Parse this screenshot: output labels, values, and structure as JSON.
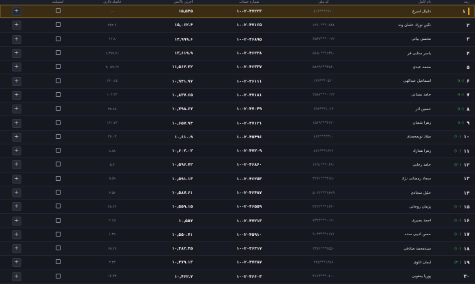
{
  "header": {
    "rank": "رتبه",
    "name": "نام کامل",
    "code": "کد ملی",
    "account": "شماره حساب",
    "balance": "آخرین بالانس",
    "distance": "فاصله دلاری",
    "consistency": "استیبلت"
  },
  "accent": "#e0a227",
  "rows": [
    {
      "rank": "۱",
      "badge": "",
      "name": "دانیال اسرغ",
      "code": "۲۷۱۰***۵۱۲",
      "account": "۱۰۰۲۰۴۷۲۲۳",
      "balance": "۱۵,۵۴۵",
      "distance": "--",
      "consistency": "lock-icon"
    },
    {
      "rank": "۲",
      "badge": "",
      "name": "نگین نوزاد عثمان وند",
      "code": "۰۷۸۸***۱۲۶۰",
      "account": "۱۰۰۲۰۴۷۱۶۵",
      "balance": "۱۵,۰۶۲.۴",
      "distance": "۴۸۲.۶",
      "consistency": "lock-icon"
    },
    {
      "rank": "۳",
      "badge": "",
      "name": "محسن بیاتی",
      "code": "۰۰۲۲***۶۵۳۷",
      "account": "۱۰۰۲۰۴۶۸۹۵",
      "balance": "۱۴,۹۹۹.۶",
      "distance": "۶۲.۸",
      "consistency": "lock-icon"
    },
    {
      "rank": "۴",
      "badge": "",
      "name": "یاسر ستایی فر",
      "code": "۱۳۹۰***۵۶۵۰",
      "account": "۱۰۰۲۰۴۶۲۲۸",
      "balance": "۱۳,۶۱۹.۹",
      "distance": "۱,۳۷۹.۷۱",
      "consistency": "lock-icon"
    },
    {
      "rank": "۵",
      "badge": "",
      "name": "محمد عبدی",
      "code": "۴۷۸۰***۵۸۲۹",
      "account": "۱۰۰۲۰۴۶۳۳۷",
      "balance": "۱۱,۵۶۲.۲۲",
      "distance": "۲,۰۵۷.۶۷",
      "consistency": "lock-icon"
    },
    {
      "rank": "۶",
      "badge": "(۱۰)",
      "name": "اسماعیل عبدالهی",
      "code": "۰۵۲۰***۱۴۹",
      "account": "۱۰۰۲۰۴۶۱۱۱",
      "balance": "۱۰,۹۴۱.۹۷",
      "distance": "۶۲۰.۲۵",
      "consistency": "lock-icon"
    },
    {
      "rank": "۷",
      "badge": "(۱۰)",
      "name": "حامد بستانی",
      "code": "۰۰۲۲***۲۵۸۷",
      "account": "۱۰۰۲۰۴۷۱۸۱",
      "balance": "۱۰,۸۳۷.۶۵",
      "distance": "۱۰۴.۳۲",
      "consistency": "lock-icon"
    },
    {
      "rank": "۸",
      "badge": "(۱۰)",
      "name": "حسین آذر",
      "code": "۱۰۶۴***۹۹۲",
      "account": "۱۰۰۲۰۴۷۰۴۹",
      "balance": "۱۰,۷۹۸.۶۷",
      "distance": "۳۸.۹۸",
      "consistency": "lock-icon"
    },
    {
      "rank": "۹",
      "badge": "(۱۰)",
      "name": "زهرا شعبان",
      "code": "۴۱۲۰***۱۵۶۹",
      "account": "۱۰۰۲۰۴۷۱۲۱",
      "balance": "۱۰,۶۵۷.۹۴",
      "distance": "۱۴۱.۷۳",
      "consistency": "lock-icon"
    },
    {
      "rank": "۱۰",
      "badge": "(۱۰)",
      "name": "میلاد نوبمحمدی",
      "code": "۳۳۱۰***۸۶۲",
      "account": "۱۰۰۲۰۴۵۴۹۶",
      "balance": "۱۰,۶۱۰.۹",
      "distance": "۴۶.۰۴",
      "consistency": "lock-icon"
    },
    {
      "rank": "۱۱",
      "badge": "(۱۰)",
      "name": "زهرا همازاد",
      "code": "۱۳۶۲***۸۷۱",
      "account": "۱۰۰۲۰۴۷۲۰۹",
      "balance": "۱۰,۶۰۲.۰۲",
      "distance": "۸.۸۸",
      "consistency": "lock-icon"
    },
    {
      "rank": "۱۲",
      "badge": "(۲۰)",
      "name": "حامد رجایی",
      "code": "۰۶۹۰***۱۴۹۱",
      "account": "۱۰۰۲۰۴۶۸۶۰",
      "balance": "۱۰,۵۹۶.۷۲",
      "distance": "۵.۳",
      "consistency": "lock-icon"
    },
    {
      "rank": "۱۳",
      "badge": "",
      "name": "سجاد رمضانی نژاد",
      "code": "۳۱۵۰***۳۲۷۱",
      "account": "۱۰۰۲۰۴۶۲۵۳",
      "balance": "۱۰,۵۹۱.۱۳",
      "distance": "۵.۵۹",
      "consistency": "lock-icon"
    },
    {
      "rank": "۱۴",
      "badge": "",
      "name": "خلیل سجادی",
      "code": "۱۸۲۹***۵۰۶۶",
      "account": "۱۰۰۲۰۴۶۴۸۷",
      "balance": "۱۰,۵۸۷.۶۱",
      "distance": "۳.۵۲",
      "consistency": "lock-icon"
    },
    {
      "rank": "۱۵",
      "badge": "(۱۰)",
      "name": "پژمان روحانی",
      "code": "۱۶۴۰***۴۴۲۲",
      "account": "۱۰۰۲۰۴۶۵۵۹",
      "balance": "۱۰,۵۵۹.۱۵",
      "distance": "۲۸.۴۶",
      "consistency": "lock-icon"
    },
    {
      "rank": "۱۶",
      "badge": "(۱۰)",
      "name": "احمد بصیری",
      "code": "۰۰۲۰***۷۳۴۴",
      "account": "۱۰۰۲۰۴۷۲۱۳",
      "balance": "۱۰,۵۵۷",
      "distance": "۲.۱۵",
      "consistency": "lock-icon"
    },
    {
      "rank": "۱۷",
      "badge": "(۱۰)",
      "name": "حسن ادیبی سده",
      "code": "۱۱۷۱***۹۰۴۳",
      "account": "۱۰۰۲۰۴۵۹۱۰",
      "balance": "۱۰,۵۵۰.۷۱",
      "distance": "۶.۲۹",
      "consistency": "lock-icon"
    },
    {
      "rank": "۱۸",
      "badge": "(۱۰)",
      "name": "سیدمحمد صادقی",
      "code": "۲۵۵۰***۲۳۷۱",
      "account": "۱۰۰۲۰۴۶۳۱۷",
      "balance": "۱۰,۴۸۲.۴۵",
      "distance": "۶۸.۲۶",
      "consistency": "lock-icon"
    },
    {
      "rank": "۱۹",
      "badge": "(۳۰)",
      "name": "ایمان آتاوی",
      "code": "۱۳۸۹***۴۴۵",
      "account": "۱۰۰۲۰۴۷۲۸۷",
      "balance": "۱۰,۴۷۹.۱۳",
      "distance": "۳.۳۳",
      "consistency": "lock-icon"
    },
    {
      "rank": "۲۰",
      "badge": "",
      "name": "پوریا یعقوبی",
      "code": "۰۸۰۰***۴۱۶۴",
      "account": "۱۰۰۲۰۴۶۶۰۳",
      "balance": "۱۰,۴۶۲.۷",
      "distance": "۱۶.۴۳",
      "consistency": "lock-icon"
    }
  ],
  "action_label": "+"
}
